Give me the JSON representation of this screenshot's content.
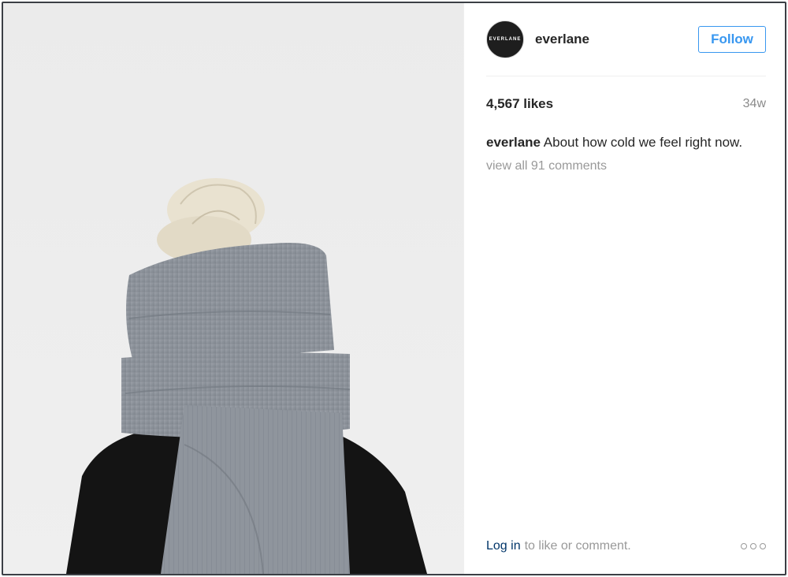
{
  "post": {
    "image_alt": "Person wrapped in a large grey knit scarf",
    "author": {
      "avatar_text": "EVERLANE",
      "username": "everlane",
      "follow_label": "Follow"
    },
    "likes": "4,567 likes",
    "age": "34w",
    "caption": {
      "username": "everlane",
      "text": "About how cold we feel right now."
    },
    "view_all_comments": "view all 91 comments",
    "footer": {
      "login_link": "Log in",
      "login_rest": "to like or comment."
    },
    "more_icon": "more-options-icon"
  },
  "colors": {
    "accent": "#3897f0",
    "link": "#003569",
    "muted": "#999999",
    "frame": "#3b3f45"
  }
}
